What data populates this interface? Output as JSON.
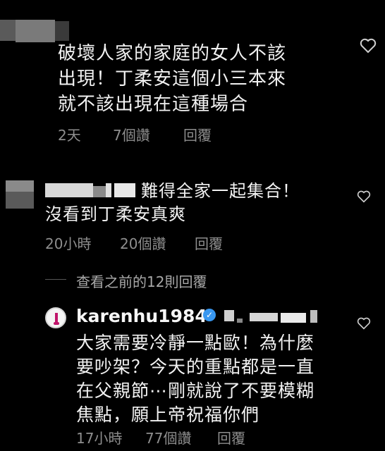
{
  "comment1": {
    "text": "破壞人家的家庭的女人不該\n出現！丁柔安這個小三本來\n就不該出現在這種場合",
    "time": "2天",
    "likes": "7個讚",
    "reply_label": "回覆"
  },
  "comment2": {
    "text_line1": "難得全家一起集合！",
    "text_line2": "沒看到丁柔安真爽",
    "time": "20小時",
    "likes": "20個讚",
    "reply_label": "回覆"
  },
  "view_replies": "查看之前的12則回覆",
  "comment3": {
    "username": "karenhu1984",
    "verified": "✓",
    "text": "大家需要冷靜一點歐！為什麼\n要吵架？今天的重點都是一直\n在父親節⋯剛就說了不要模糊\n焦點，願上帝祝福你們",
    "time": "17小時",
    "likes": "77個讚",
    "reply_label": "回覆"
  },
  "colors": {
    "background": "#000000",
    "text": "#f2f2f2",
    "meta": "#8e8e8e",
    "verified": "#3897f0"
  },
  "icons": [
    "heart-outline-icon",
    "verified-badge-icon"
  ]
}
